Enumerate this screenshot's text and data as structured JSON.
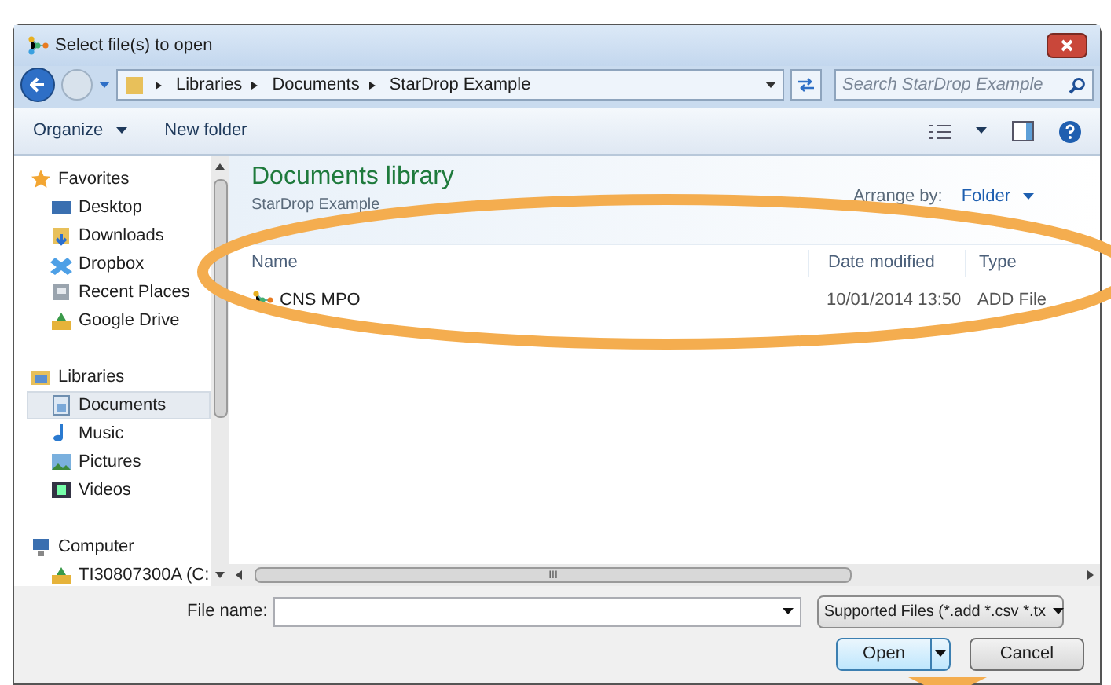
{
  "window": {
    "title": "Select file(s) to open"
  },
  "address": {
    "crumbs": [
      "Libraries",
      "Documents",
      "StarDrop Example"
    ],
    "search_placeholder": "Search StarDrop Example"
  },
  "toolbar": {
    "organize": "Organize",
    "new_folder": "New folder"
  },
  "sidebar": {
    "groups": [
      {
        "heading": "Favorites",
        "items": [
          {
            "label": "Desktop",
            "selected": false
          },
          {
            "label": "Downloads",
            "selected": false
          },
          {
            "label": "Dropbox",
            "selected": false
          },
          {
            "label": "Recent Places",
            "selected": false
          },
          {
            "label": "Google Drive",
            "selected": false
          }
        ]
      },
      {
        "heading": "Libraries",
        "items": [
          {
            "label": "Documents",
            "selected": true
          },
          {
            "label": "Music",
            "selected": false
          },
          {
            "label": "Pictures",
            "selected": false
          },
          {
            "label": "Videos",
            "selected": false
          }
        ]
      },
      {
        "heading": "Computer",
        "items": [
          {
            "label": "TI30807300A (C:",
            "selected": false
          }
        ]
      }
    ]
  },
  "library": {
    "title": "Documents library",
    "subtitle": "StarDrop Example",
    "arrange_label": "Arrange by:",
    "arrange_value": "Folder"
  },
  "table": {
    "columns": [
      "Name",
      "Date modified",
      "Type"
    ],
    "rows": [
      {
        "name": "CNS MPO",
        "date": "10/01/2014 13:50",
        "type": "ADD File"
      }
    ]
  },
  "scroll_grip": "III",
  "footer": {
    "file_name_label": "File name:",
    "file_type": "Supported Files (*.add *.csv *.tx",
    "open": "Open",
    "cancel": "Cancel"
  }
}
